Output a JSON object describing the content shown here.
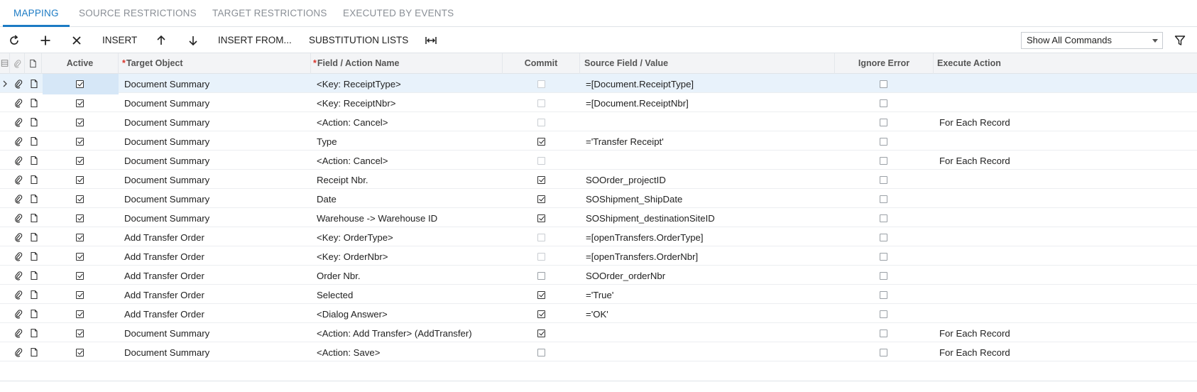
{
  "tabs": [
    {
      "label": "MAPPING",
      "active": true
    },
    {
      "label": "SOURCE RESTRICTIONS",
      "active": false
    },
    {
      "label": "TARGET RESTRICTIONS",
      "active": false
    },
    {
      "label": "EXECUTED BY EVENTS",
      "active": false
    }
  ],
  "toolbar": {
    "refresh_icon": "refresh-icon",
    "add_icon": "plus-icon",
    "delete_icon": "close-icon",
    "insert_label": "INSERT",
    "move_up_icon": "arrow-up-icon",
    "move_down_icon": "arrow-down-icon",
    "insert_from_label": "INSERT FROM...",
    "substitution_lists_label": "SUBSTITUTION LISTS",
    "fit_columns_icon": "fit-columns-icon",
    "command_filter_value": "Show All Commands",
    "filter_icon": "filter-icon"
  },
  "grid": {
    "headers": {
      "active": "Active",
      "target_object": "Target Object",
      "field_action": "Field / Action Name",
      "commit": "Commit",
      "source_field": "Source Field / Value",
      "ignore_error": "Ignore Error",
      "execute_action": "Execute Action"
    },
    "required_marker": "*",
    "rows": [
      {
        "active": true,
        "target": "Document Summary",
        "field": "<Key: ReceiptType>",
        "commit": false,
        "commit_dim": true,
        "source": "=[Document.ReceiptType]",
        "ignore_error": false,
        "execute": ""
      },
      {
        "active": true,
        "target": "Document Summary",
        "field": "<Key: ReceiptNbr>",
        "commit": false,
        "commit_dim": true,
        "source": "=[Document.ReceiptNbr]",
        "ignore_error": false,
        "execute": ""
      },
      {
        "active": true,
        "target": "Document Summary",
        "field": "<Action: Cancel>",
        "commit": false,
        "commit_dim": true,
        "source": "",
        "ignore_error": false,
        "execute": "For Each Record"
      },
      {
        "active": true,
        "target": "Document Summary",
        "field": "Type",
        "commit": true,
        "commit_dim": false,
        "source": "='Transfer Receipt'",
        "ignore_error": false,
        "execute": ""
      },
      {
        "active": true,
        "target": "Document Summary",
        "field": "<Action: Cancel>",
        "commit": false,
        "commit_dim": true,
        "source": "",
        "ignore_error": false,
        "execute": "For Each Record"
      },
      {
        "active": true,
        "target": "Document Summary",
        "field": "Receipt Nbr.",
        "commit": true,
        "commit_dim": false,
        "source": "SOOrder_projectID",
        "ignore_error": false,
        "execute": ""
      },
      {
        "active": true,
        "target": "Document Summary",
        "field": "Date",
        "commit": true,
        "commit_dim": false,
        "source": "SOShipment_ShipDate",
        "ignore_error": false,
        "execute": ""
      },
      {
        "active": true,
        "target": "Document Summary",
        "field": "Warehouse -> Warehouse ID",
        "commit": true,
        "commit_dim": false,
        "source": "SOShipment_destinationSiteID",
        "ignore_error": false,
        "execute": ""
      },
      {
        "active": true,
        "target": "Add Transfer Order",
        "field": "<Key: OrderType>",
        "commit": false,
        "commit_dim": true,
        "source": "=[openTransfers.OrderType]",
        "ignore_error": false,
        "execute": ""
      },
      {
        "active": true,
        "target": "Add Transfer Order",
        "field": "<Key: OrderNbr>",
        "commit": false,
        "commit_dim": true,
        "source": "=[openTransfers.OrderNbr]",
        "ignore_error": false,
        "execute": ""
      },
      {
        "active": true,
        "target": "Add Transfer Order",
        "field": "Order Nbr.",
        "commit": false,
        "commit_dim": false,
        "source": "SOOrder_orderNbr",
        "ignore_error": false,
        "execute": ""
      },
      {
        "active": true,
        "target": "Add Transfer Order",
        "field": "Selected",
        "commit": true,
        "commit_dim": false,
        "source": "='True'",
        "ignore_error": false,
        "execute": ""
      },
      {
        "active": true,
        "target": "Add Transfer Order",
        "field": "<Dialog Answer>",
        "commit": true,
        "commit_dim": false,
        "source": "='OK'",
        "ignore_error": false,
        "execute": ""
      },
      {
        "active": true,
        "target": "Document Summary",
        "field": "<Action: Add Transfer> (AddTransfer)",
        "commit": true,
        "commit_dim": false,
        "source": "",
        "ignore_error": false,
        "execute": "For Each Record"
      },
      {
        "active": true,
        "target": "Document Summary",
        "field": "<Action: Save>",
        "commit": false,
        "commit_dim": false,
        "source": "",
        "ignore_error": false,
        "execute": "For Each Record"
      }
    ]
  },
  "colors": {
    "accent": "#1c7bc4",
    "selected_row": "#e8f2fb",
    "required": "#d9342b"
  }
}
